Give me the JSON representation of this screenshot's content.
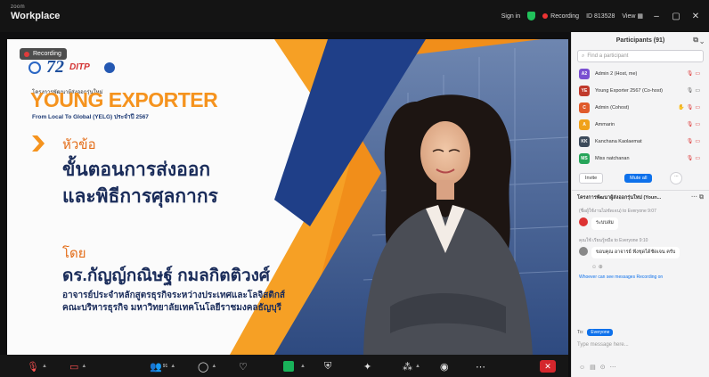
{
  "titlebar": {
    "brand_small": "zoom",
    "brand": "Workplace",
    "signin": "Sign in",
    "recording": "Recording",
    "meeting_id": "ID 813528",
    "view": "View"
  },
  "slide": {
    "recording_badge": "Recording",
    "logo_72": "72",
    "logo_ditp": "DITP",
    "project_line": "โครงการพัฒนาผู้ส่งออกรุ่นใหม่",
    "brand_title": "YOUNG EXPORTER",
    "brand_sub": "From Local To Global (YELG) ประจำปี 2567",
    "topic_label": "หัวข้อ",
    "topic_line1": "ขั้นตอนการส่งออก",
    "topic_line2": "และพิธีการศุลกากร",
    "by_label": "โดย",
    "speaker_name": "ดร.กัญญ์กณิษฐ์ กมลกิตติวงศ์",
    "speaker_role1": "อาจารย์ประจำหลักสูตรธุรกิจระหว่างประเทศและโลจิสติกส์",
    "speaker_role2": "คณะบริหารธุรกิจ มหาวิทยาลัยเทคโนโลยีราชมงคลธัญบุรี"
  },
  "toolbar": {
    "icons": [
      "mic-muted-icon",
      "video-muted-icon",
      "participants-icon",
      "chat-icon",
      "react-icon",
      "share-icon",
      "security-icon",
      "apps-icon",
      "more-icon",
      "record-icon",
      "options-icon",
      "end-icon"
    ],
    "participants_count": "91"
  },
  "participants_panel": {
    "title": "Participants (91)",
    "search_placeholder": "Find a participant",
    "rows": [
      {
        "initials": "A2",
        "color": "#7a4fd1",
        "name": "Admin 2 (Host, me)"
      },
      {
        "initials": "YE",
        "color": "#c0392b",
        "name": "Young Exporter 2567 (Co-host)"
      },
      {
        "initials": "C",
        "color": "#e05a2b",
        "name": "Admin (Cohost)"
      },
      {
        "initials": "A",
        "color": "#f0a21b",
        "name": "Ammarin"
      },
      {
        "initials": "KK",
        "color": "#3c4a5a",
        "name": "Kanchana Kaolaemat"
      },
      {
        "initials": "MS",
        "color": "#27a55a",
        "name": "Miss natchanan"
      }
    ],
    "invite_label": "Invite",
    "mute_all_label": "Mute all",
    "more_label": "..."
  },
  "chat_panel": {
    "title": "โครงการพัฒนาผู้ส่งออกรุ่นใหม่ (Youn...",
    "msg1_meta": "(ชื่อผู้ใช้งานไม่ชัดเจน) to Everyone 9:07",
    "msg1_text": "ระบบล่ม",
    "msg2_meta": "คุณใช้ เรียนรู้หมือ to Everyone 9:10",
    "msg2_text": "ขอบคุณ อาจารย์ ฟังชุดได้ชัดเจน ครับ",
    "sys_note": "Whoever can see messages Recording on",
    "to_label": "To:",
    "to_chip": "Everyone",
    "input_placeholder": "Type message here...",
    "compose_icons": [
      "emoji-icon",
      "file-icon",
      "screenshot-icon",
      "more-icon"
    ]
  },
  "colors": {
    "accent_orange": "#f5931e",
    "navy": "#1a2c5a",
    "zoom_blue": "#0e71eb"
  }
}
